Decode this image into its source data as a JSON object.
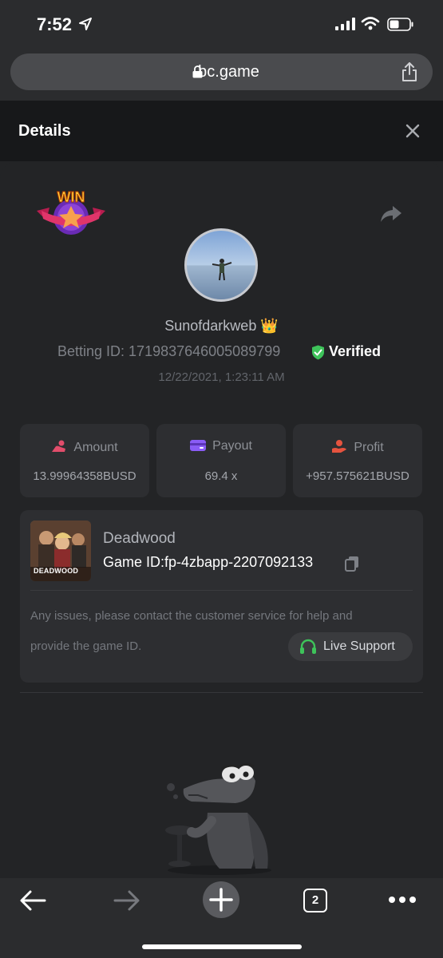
{
  "status_bar": {
    "time": "7:52",
    "icons": [
      "location-arrow-icon",
      "cellular-signal-icon",
      "wifi-icon",
      "battery-icon"
    ]
  },
  "browser": {
    "url": "bc.game",
    "icons": [
      "lock-icon",
      "share-icon"
    ]
  },
  "details": {
    "title": "Details",
    "close_icon": "close-icon"
  },
  "bet": {
    "badge": "WIN",
    "username": "Sunofdarkweb 👑",
    "betting_id_label": "Betting ID: 1719837646005089799",
    "verified_label": "Verified",
    "datetime": "12/22/2021, 1:23:11 AM"
  },
  "stats": [
    {
      "label": "Amount",
      "value": "13.99964358BUSD",
      "icon": "coins-hand-icon",
      "color": "#e24d6b"
    },
    {
      "label": "Payout",
      "value": "69.4 x",
      "icon": "wallet-card-icon",
      "color": "#8a5cf6"
    },
    {
      "label": "Profit",
      "value": "+957.575621BUSD",
      "icon": "hand-coin-icon",
      "color": "#e5533f"
    }
  ],
  "game": {
    "name": "Deadwood",
    "thumb_label": "DEADWOOD",
    "game_id": "Game ID:fp-4zbapp-2207092133",
    "note_line1": "Any issues, please contact the customer service for help and",
    "note_line2": "provide the game ID.",
    "live_support": "Live Support"
  },
  "toolbar": {
    "tab_count": "2",
    "icons": [
      "back-arrow-icon",
      "forward-arrow-icon",
      "new-tab-plus-icon",
      "tabs-icon",
      "more-icon"
    ]
  },
  "colors": {
    "background": "#232426",
    "card": "#2d2e31",
    "verified_green": "#3ec35a"
  }
}
